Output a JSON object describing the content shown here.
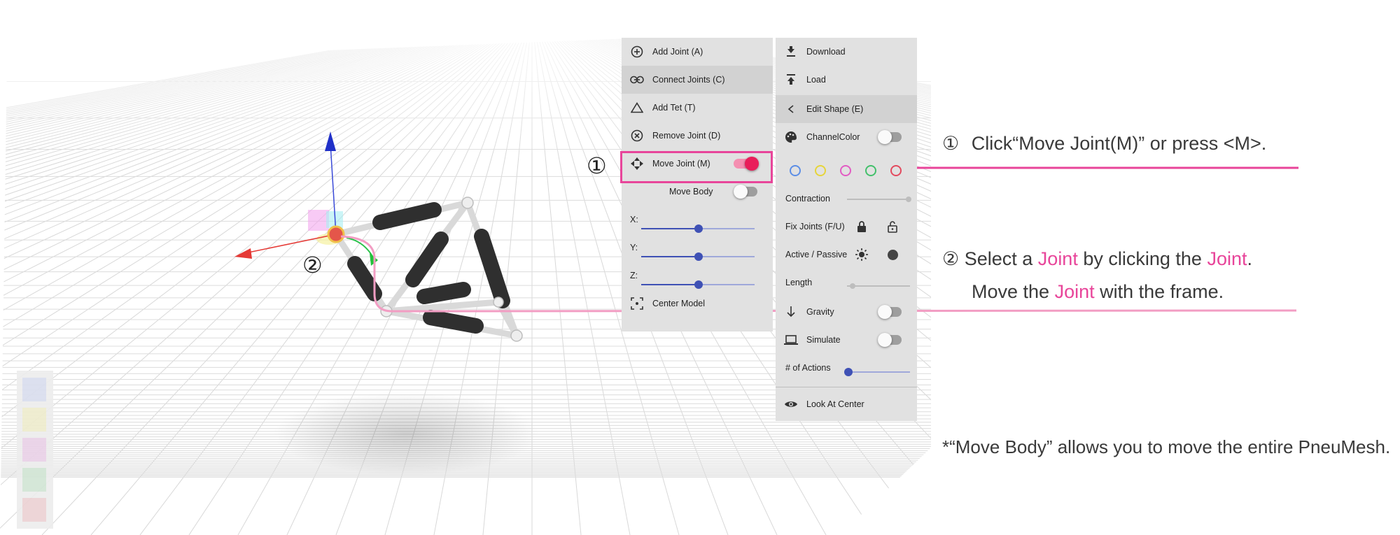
{
  "left_menu": {
    "add_joint": "Add Joint (A)",
    "connect_joints": "Connect Joints (C)",
    "add_tet": "Add Tet (T)",
    "remove_joint": "Remove Joint (D)",
    "move_joint": "Move Joint (M)",
    "move_joint_on": true,
    "move_body": "Move Body",
    "move_body_on": false,
    "x_label": "X:",
    "y_label": "Y:",
    "z_label": "Z:",
    "center_model": "Center Model"
  },
  "right_menu": {
    "download": "Download",
    "load": "Load",
    "edit_shape": "Edit Shape (E)",
    "channel_color": "ChannelColor",
    "channel_colors": [
      "#5c8ee6",
      "#e6d53a",
      "#e25cc3",
      "#43c06b",
      "#e34a5e"
    ],
    "contraction": "Contraction",
    "fix_joints": "Fix Joints (F/U)",
    "active_passive": "Active / Passive",
    "length": "Length",
    "gravity": "Gravity",
    "simulate": "Simulate",
    "num_actions": "# of Actions",
    "look_at_center": "Look At Center"
  },
  "annotations": {
    "step1_marker": "①",
    "step1_text": "Click“Move Joint(M)” or press <M>.",
    "step2_marker": "②",
    "step2_line1_a": "Select a ",
    "step2_line1_b": "Joint",
    "step2_line1_c": " by clicking the ",
    "step2_line1_d": "Joint",
    "step2_line1_e": ".",
    "step2_line2_a": "Move the ",
    "step2_line2_b": "Joint",
    "step2_line2_c": " with the frame.",
    "note": "*“Move Body” allows you to move the entire PneuMesh.",
    "callout1_marker": "①",
    "callout2_marker": "②"
  },
  "colors": {
    "accent_pink": "#e8459a",
    "toggle_on": "#e91e5a",
    "slider_blue": "#3f51b5",
    "panel_bg": "#e1e1e1"
  }
}
